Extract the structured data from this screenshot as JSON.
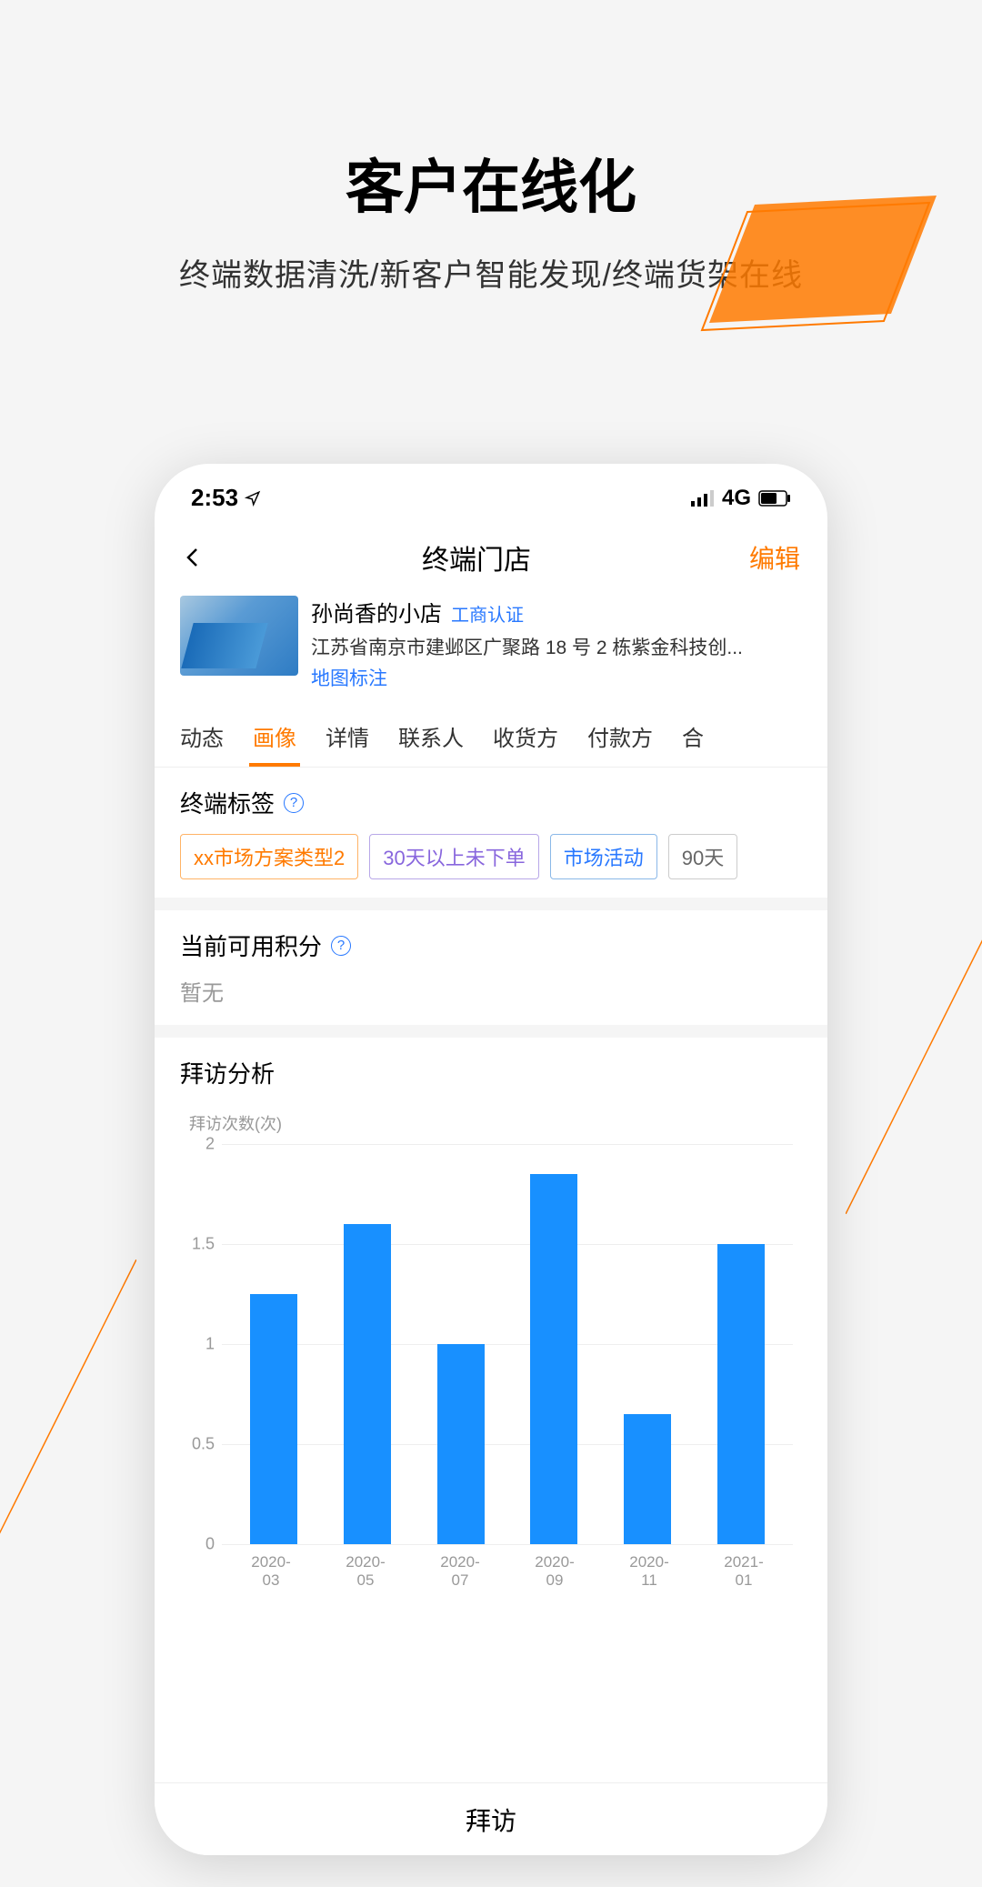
{
  "marketing": {
    "title": "客户在线化",
    "subtitle": "终端数据清洗/新客户智能发现/终端货架在线"
  },
  "status_bar": {
    "time": "2:53",
    "network": "4G"
  },
  "nav": {
    "title": "终端门店",
    "edit": "编辑"
  },
  "store": {
    "name": "孙尚香的小店",
    "cert": "工商认证",
    "address": "江苏省南京市建邺区广聚路 18 号 2 栋紫金科技创...",
    "map_link": "地图标注"
  },
  "tabs": [
    "动态",
    "画像",
    "详情",
    "联系人",
    "收货方",
    "付款方",
    "合"
  ],
  "active_tab_index": 1,
  "terminal_tags": {
    "title": "终端标签",
    "items": [
      {
        "label": "xx市场方案类型2",
        "style": "orange"
      },
      {
        "label": "30天以上未下单",
        "style": "purple"
      },
      {
        "label": "市场活动",
        "style": "blue"
      },
      {
        "label": "90天",
        "style": "gray"
      }
    ]
  },
  "points": {
    "title": "当前可用积分",
    "value": "暂无"
  },
  "visit": {
    "title": "拜访分析",
    "ylabel": "拜访次数(次)"
  },
  "bottom_button": "拜访",
  "chart_data": {
    "type": "bar",
    "title": "拜访分析",
    "ylabel": "拜访次数(次)",
    "xlabel": "",
    "categories": [
      "2020-03",
      "2020-05",
      "2020-07",
      "2020-09",
      "2020-11",
      "2021-01"
    ],
    "values": [
      1.25,
      1.6,
      1.0,
      1.85,
      0.65,
      1.5
    ],
    "ylim": [
      0,
      2
    ],
    "yticks": [
      0,
      0.5,
      1,
      1.5,
      2
    ]
  }
}
